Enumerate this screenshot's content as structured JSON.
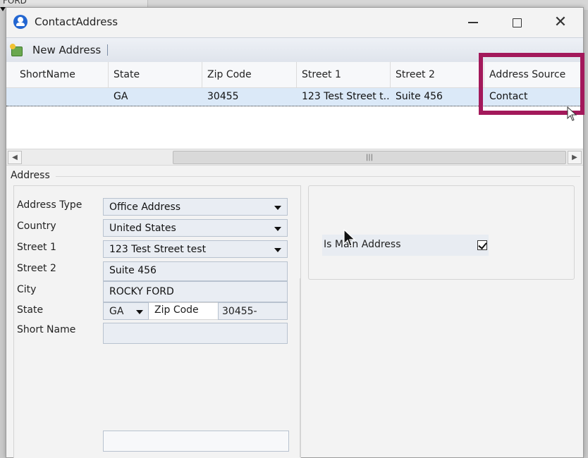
{
  "background": {
    "text": "FORD"
  },
  "window": {
    "title": "ContactAddress",
    "controls": {
      "minimize": "—",
      "maximize": "□",
      "close": "✕"
    }
  },
  "toolbar": {
    "new_address_label": "New Address"
  },
  "grid": {
    "columns": [
      "ShortName",
      "State",
      "Zip Code",
      "Street 1",
      "Street 2",
      "Address Source"
    ],
    "rows": [
      {
        "ShortName": "",
        "State": "GA",
        "Zip Code": "30455",
        "Street 1": "123 Test Street t...",
        "Street 2": "Suite 456",
        "Address Source": "Contact"
      }
    ],
    "highlight_color": "#a3195b"
  },
  "scrollbar": {
    "left": "◀",
    "right": "▶",
    "thumb": "|||"
  },
  "address": {
    "group_title": "Address",
    "labels": {
      "address_type": "Address Type",
      "country": "Country",
      "street1": "Street 1",
      "street2": "Street 2",
      "city": "City",
      "state": "State",
      "zip_code": "Zip Code",
      "short_name": "Short Name"
    },
    "values": {
      "address_type": "Office Address",
      "country": "United States",
      "street1": "123 Test Street test",
      "street2": "Suite 456",
      "city": "ROCKY FORD",
      "state": "GA",
      "zip_code": "30455-",
      "short_name": ""
    },
    "is_main_address": {
      "label": "Is Main Address",
      "checked": true
    }
  }
}
